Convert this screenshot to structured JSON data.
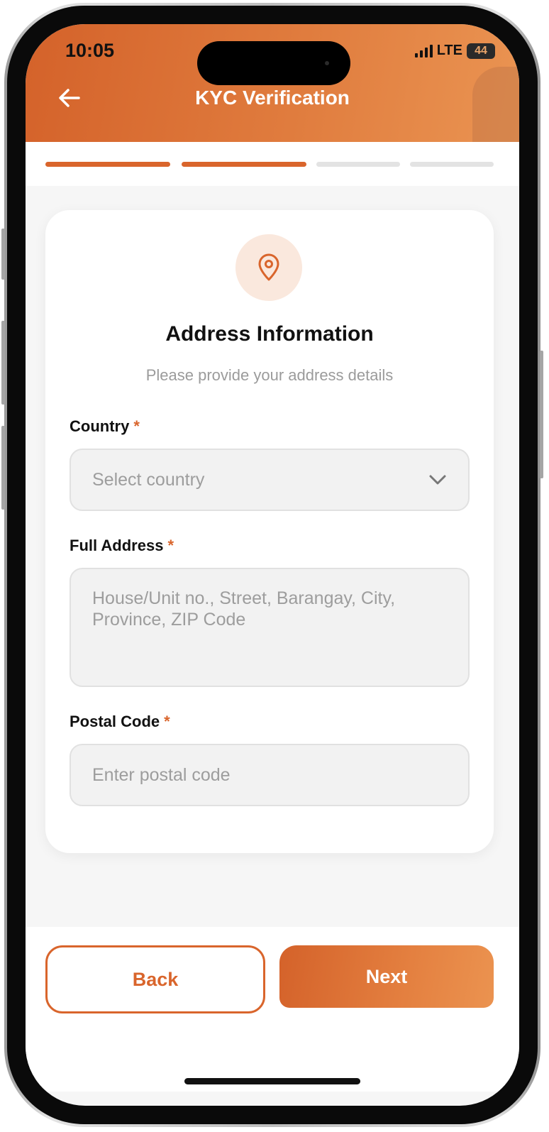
{
  "status_bar": {
    "time": "10:05",
    "network": "LTE",
    "battery": "44"
  },
  "header": {
    "title": "KYC Verification",
    "back_icon": "arrow-left-icon"
  },
  "progress": {
    "total_steps": 4,
    "completed_steps": 2,
    "active_color": "#d9652c",
    "inactive_color": "#e3e3e3"
  },
  "card": {
    "icon": "location-pin-icon",
    "title": "Address Information",
    "subtitle": "Please provide your address details"
  },
  "form": {
    "country": {
      "label": "Country",
      "required_mark": "*",
      "placeholder": "Select country"
    },
    "full_address": {
      "label": "Full Address",
      "required_mark": "*",
      "placeholder": "House/Unit no., Street, Barangay, City, Province, ZIP Code"
    },
    "postal_code": {
      "label": "Postal Code",
      "required_mark": "*",
      "placeholder": "Enter postal code"
    }
  },
  "actions": {
    "back_label": "Back",
    "next_label": "Next"
  },
  "colors": {
    "accent": "#d9652c",
    "accent_light": "#fae8dd",
    "header_gradient_end": "#ea9452"
  }
}
